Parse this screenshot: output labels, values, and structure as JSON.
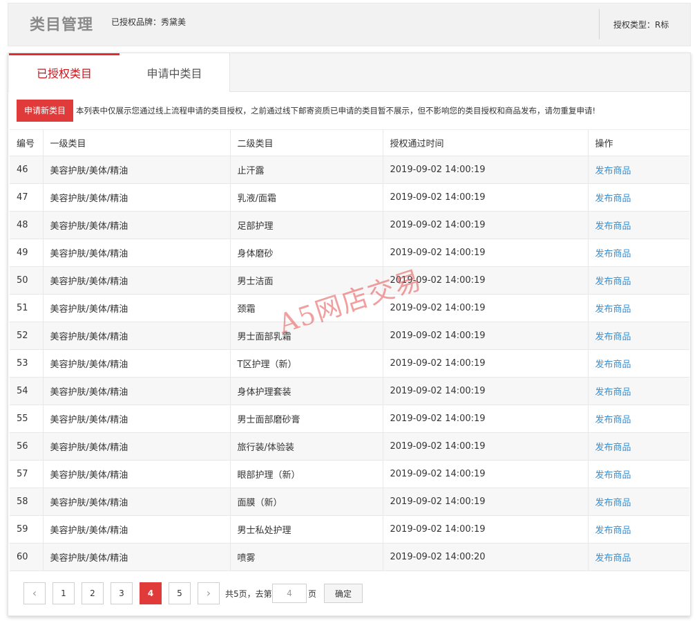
{
  "header": {
    "title": "类目管理",
    "brand": "已授权品牌：秀黛美",
    "auth_type": "授权类型：R标"
  },
  "tabs": [
    {
      "label": "已授权类目",
      "active": true
    },
    {
      "label": "申请中类目",
      "active": false
    }
  ],
  "notice": {
    "button_label": "申请新类目",
    "text": "本列表中仅展示您通过线上流程申请的类目授权，之前通过线下邮寄资质已申请的类目暂不展示，但不影响您的类目授权和商品发布，请勿重复申请!"
  },
  "table": {
    "columns": [
      "编号",
      "一级类目",
      "二级类目",
      "授权通过时间",
      "操作"
    ],
    "rows": [
      {
        "id": "46",
        "level1": "美容护肤/美体/精油",
        "level2": "止汗露",
        "time": "2019-09-02 14:00:19",
        "action": "发布商品"
      },
      {
        "id": "47",
        "level1": "美容护肤/美体/精油",
        "level2": "乳液/面霜",
        "time": "2019-09-02 14:00:19",
        "action": "发布商品"
      },
      {
        "id": "48",
        "level1": "美容护肤/美体/精油",
        "level2": "足部护理",
        "time": "2019-09-02 14:00:19",
        "action": "发布商品"
      },
      {
        "id": "49",
        "level1": "美容护肤/美体/精油",
        "level2": "身体磨砂",
        "time": "2019-09-02 14:00:19",
        "action": "发布商品"
      },
      {
        "id": "50",
        "level1": "美容护肤/美体/精油",
        "level2": "男士洁面",
        "time": "2019-09-02 14:00:19",
        "action": "发布商品"
      },
      {
        "id": "51",
        "level1": "美容护肤/美体/精油",
        "level2": "颈霜",
        "time": "2019-09-02 14:00:19",
        "action": "发布商品"
      },
      {
        "id": "52",
        "level1": "美容护肤/美体/精油",
        "level2": "男士面部乳霜",
        "time": "2019-09-02 14:00:19",
        "action": "发布商品"
      },
      {
        "id": "53",
        "level1": "美容护肤/美体/精油",
        "level2": "T区护理（新）",
        "time": "2019-09-02 14:00:19",
        "action": "发布商品"
      },
      {
        "id": "54",
        "level1": "美容护肤/美体/精油",
        "level2": "身体护理套装",
        "time": "2019-09-02 14:00:19",
        "action": "发布商品"
      },
      {
        "id": "55",
        "level1": "美容护肤/美体/精油",
        "level2": "男士面部磨砂膏",
        "time": "2019-09-02 14:00:19",
        "action": "发布商品"
      },
      {
        "id": "56",
        "level1": "美容护肤/美体/精油",
        "level2": "旅行装/体验装",
        "time": "2019-09-02 14:00:19",
        "action": "发布商品"
      },
      {
        "id": "57",
        "level1": "美容护肤/美体/精油",
        "level2": "眼部护理（新）",
        "time": "2019-09-02 14:00:19",
        "action": "发布商品"
      },
      {
        "id": "58",
        "level1": "美容护肤/美体/精油",
        "level2": "面膜（新）",
        "time": "2019-09-02 14:00:19",
        "action": "发布商品"
      },
      {
        "id": "59",
        "level1": "美容护肤/美体/精油",
        "level2": "男士私处护理",
        "time": "2019-09-02 14:00:19",
        "action": "发布商品"
      },
      {
        "id": "60",
        "level1": "美容护肤/美体/精油",
        "level2": "喷雾",
        "time": "2019-09-02 14:00:20",
        "action": "发布商品"
      }
    ]
  },
  "pager": {
    "prev_icon": "chevron-left-icon",
    "next_icon": "chevron-right-icon",
    "pages": [
      "1",
      "2",
      "3",
      "4",
      "5"
    ],
    "current": "4",
    "total_text": "共5页，去第",
    "goto_value": "4",
    "page_unit": "页",
    "confirm_label": "确定"
  },
  "watermark": "A5网店交易",
  "colors": {
    "accent": "#e03a3a",
    "link": "#3b8ecf",
    "active_tab_text": "#c8161d"
  }
}
